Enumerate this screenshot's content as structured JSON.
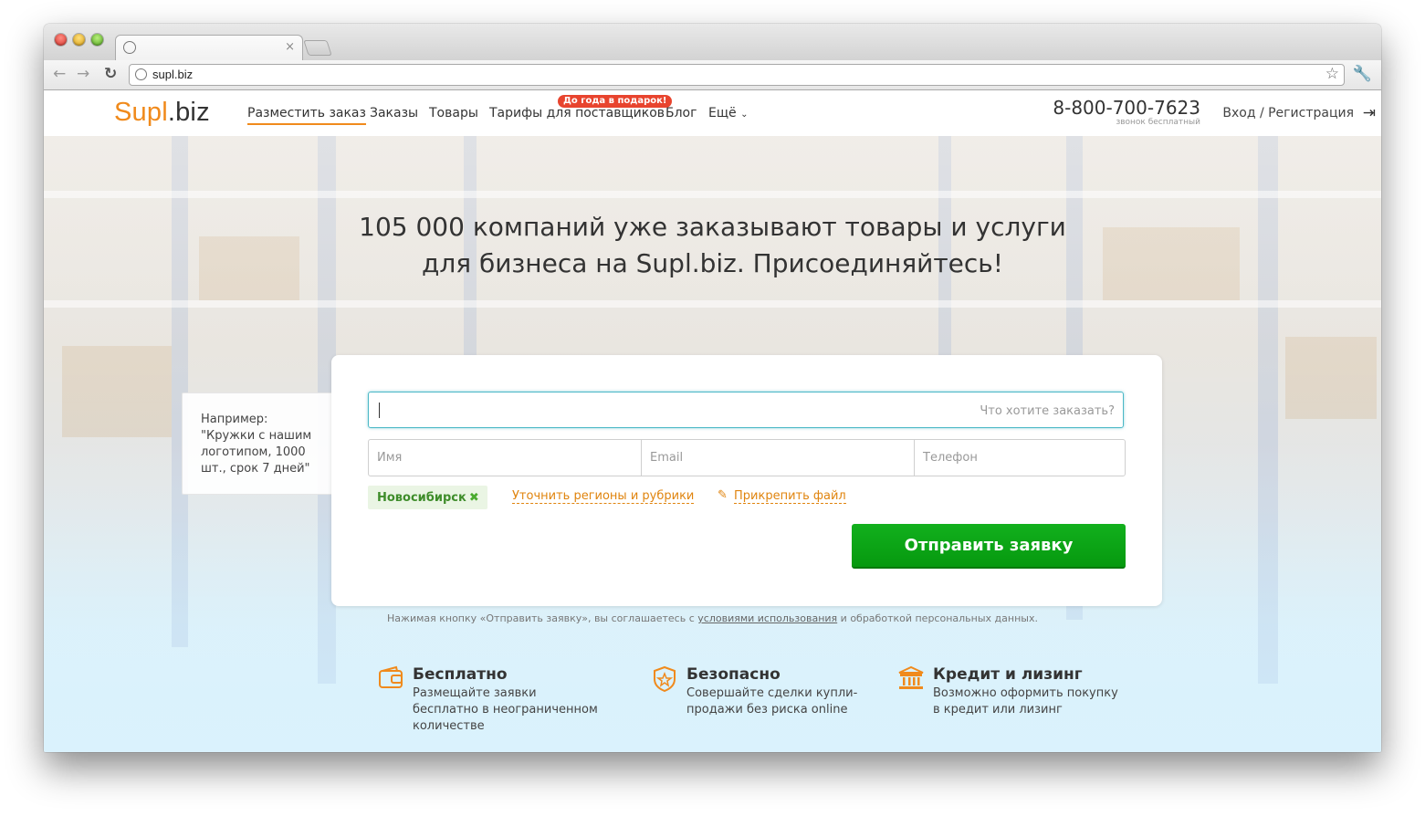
{
  "browser": {
    "tab_close": "×",
    "url": "supl.biz"
  },
  "site": {
    "logo_part1": "Supl",
    "logo_part2": ".biz",
    "nav": [
      {
        "label": "Разместить заказ"
      },
      {
        "label": "Заказы"
      },
      {
        "label": "Товары"
      },
      {
        "label": "Тарифы для поставщиков"
      },
      {
        "label": "Блог"
      },
      {
        "label": "Ещё"
      }
    ],
    "promo_badge": "До года в подарок!",
    "phone": "8-800-700-7623",
    "phone_note": "звонок бесплатный",
    "login": "Вход / Регистрация"
  },
  "hero": {
    "headline_line1": "105 000 компаний уже заказывают товары и услуги",
    "headline_line2": "для бизнеса на Supl.biz. Присоединяйтесь!",
    "hint_text": "Например: \"Кружки с нашим логотипом, 1000 шт., срок 7 дней\"",
    "order_placeholder": "Что хотите заказать?",
    "name_placeholder": "Имя",
    "email_placeholder": "Email",
    "phone_placeholder": "Телефон",
    "city": "Новосибирск",
    "regions_link": "Уточнить регионы и рубрики",
    "attach_link": "Прикрепить файл",
    "submit_label": "Отправить заявку",
    "terms_before": "Нажимая кнопку «Отправить заявку», вы соглашаетесь с ",
    "terms_link": "условиями использования",
    "terms_after": " и обработкой персональных данных."
  },
  "features": [
    {
      "icon": "wallet-icon",
      "title": "Бесплатно",
      "desc": "Размещайте заявки бесплатно в неограниченном количестве"
    },
    {
      "icon": "shield-icon",
      "title": "Безопасно",
      "desc": "Совершайте сделки купли-продажи без риска online"
    },
    {
      "icon": "bank-icon",
      "title": "Кредит и лизинг",
      "desc": "Возможно оформить покупку в кредит или лизинг"
    }
  ],
  "colors": {
    "accent_orange": "#f08a1c",
    "submit_green": "#0aa414",
    "promo_red": "#e8442e"
  }
}
